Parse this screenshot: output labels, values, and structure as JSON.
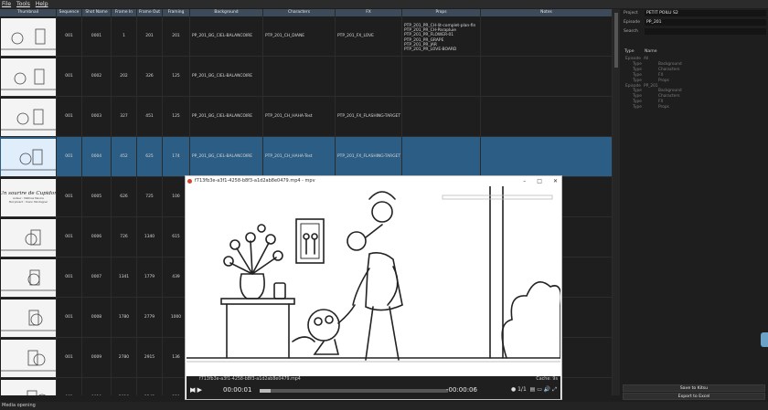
{
  "menu": [
    "File",
    "Tools",
    "Help"
  ],
  "columns": [
    "Thumbnail",
    "Sequence",
    "Shot Name",
    "Frame In",
    "Frame Out",
    "Framing",
    "Background",
    "Characters",
    "FX",
    "Props",
    "Notes"
  ],
  "rows": [
    {
      "seq": "001",
      "shot": "0001",
      "in": "1",
      "out": "201",
      "framing": "201",
      "bg": "PP_201_BG_CIEL-BALANCOIRE",
      "chars": "PTP_201_CH_DIANE",
      "fx": "PTP_201_FX_LOVE",
      "props": [
        "PTP_201_PR_CH-lit-complet-plan-fin",
        "PTP_201_PR_CH-Parapluie",
        "PTP_201_PR_FLOWER-01",
        "PTP_201_PR_GRAPE",
        "PTP_201_PR_JAR",
        "PTP_201_PR_LOVE-BOARD"
      ],
      "selected": false
    },
    {
      "seq": "001",
      "shot": "0002",
      "in": "202",
      "out": "326",
      "framing": "125",
      "bg": "PP_201_BG_CIEL-BALANCOIRE",
      "chars": "",
      "fx": "",
      "props": [],
      "selected": false
    },
    {
      "seq": "001",
      "shot": "0003",
      "in": "327",
      "out": "451",
      "framing": "125",
      "bg": "PP_201_BG_CIEL-BALANCOIRE",
      "chars": "PTP_201_CH_HAHA-Test",
      "fx": "PTP_201_FX_FLASHING-TARGET",
      "props": [],
      "selected": false
    },
    {
      "seq": "001",
      "shot": "0004",
      "in": "452",
      "out": "625",
      "framing": "174",
      "bg": "PP_201_BG_CIEL-BALANCOIRE",
      "chars": "PTP_201_CH_HAHA-Test",
      "fx": "PTP_201_FX_FLASHING-TARGET",
      "props": [],
      "selected": true
    },
    {
      "seq": "001",
      "shot": "0005",
      "in": "626",
      "out": "725",
      "framing": "100",
      "bg": "",
      "chars": "",
      "fx": "",
      "props": [],
      "selected": false
    },
    {
      "seq": "001",
      "shot": "0006",
      "in": "726",
      "out": "1340",
      "framing": "615",
      "bg": "",
      "chars": "",
      "fx": "",
      "props": [],
      "selected": false
    },
    {
      "seq": "001",
      "shot": "0007",
      "in": "1341",
      "out": "1779",
      "framing": "439",
      "bg": "",
      "chars": "",
      "fx": "",
      "props": [],
      "selected": false
    },
    {
      "seq": "001",
      "shot": "0008",
      "in": "1780",
      "out": "2779",
      "framing": "1000",
      "bg": "",
      "chars": "",
      "fx": "",
      "props": [],
      "selected": false
    },
    {
      "seq": "001",
      "shot": "0009",
      "in": "2780",
      "out": "2915",
      "framing": "136",
      "bg": "",
      "chars": "",
      "fx": "",
      "props": [],
      "selected": false
    },
    {
      "seq": "001",
      "shot": "0010",
      "in": "2916",
      "out": "3245",
      "framing": "330",
      "bg": "",
      "chars": "",
      "fx": "",
      "props": [],
      "selected": false
    }
  ],
  "thumb_titles": {
    "book_title": "Un sourire de Cupidon",
    "book_sub1": "Auteur : Mathias Mevins",
    "book_sub2": "Storyboard : Yoann Montagner"
  },
  "side": {
    "project_label": "Project",
    "project_value": "PETIT POILU S2",
    "episode_label": "Episode",
    "episode_value": "PP_201",
    "search_label": "Search",
    "tree_headers": [
      "Type",
      "Name"
    ],
    "tree": [
      {
        "k": "Episode",
        "v": "All"
      },
      {
        "k": "Type",
        "v": "Background"
      },
      {
        "k": "Type",
        "v": "Characters"
      },
      {
        "k": "Type",
        "v": "FX"
      },
      {
        "k": "Type",
        "v": "Props"
      },
      {
        "k": "Episode",
        "v": "PP_201"
      },
      {
        "k": "Type",
        "v": "Background"
      },
      {
        "k": "Type",
        "v": "Characters"
      },
      {
        "k": "Type",
        "v": "FX"
      },
      {
        "k": "Type",
        "v": "Props"
      }
    ],
    "save_label": "Save to Kitsu",
    "export_label": "Export to Excel"
  },
  "player": {
    "title": "f713fb3e-a3f1-4258-b8f3-a1d2ab8e0479.mp4 - mpv",
    "file": "f713fb3e-a3f1-4258-b8f3-a1d2ab8e0479.mp4",
    "cache": "Cache:   9s",
    "time_now": "00:00:01",
    "time_left": "-00:00:06",
    "chapter": "1/1",
    "progress": 0.06
  },
  "status": "Media opening"
}
